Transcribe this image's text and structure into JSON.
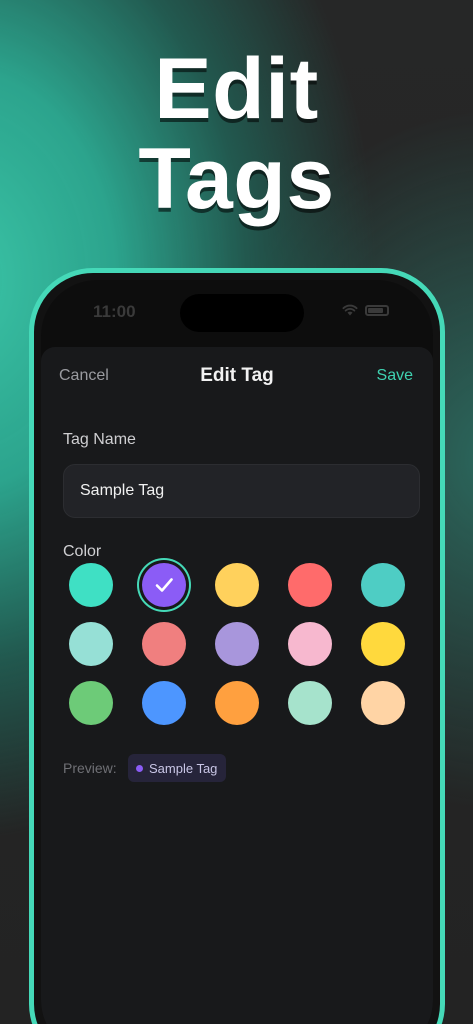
{
  "headline": {
    "line1": "Edit",
    "line2": "Tags"
  },
  "status_bar": {
    "time": "11:00"
  },
  "navbar": {
    "cancel": "Cancel",
    "title": "Edit Tag",
    "save": "Save"
  },
  "form": {
    "name_label": "Tag Name",
    "name_value": "Sample Tag",
    "color_label": "Color",
    "selected_color_index": 1,
    "colors": [
      "#3fe0c4",
      "#8b5cf6",
      "#ffd15c",
      "#ff6b6b",
      "#4ecdc4",
      "#96e0d6",
      "#f07f7f",
      "#a896dc",
      "#f7b8cf",
      "#ffd93d",
      "#6dcb78",
      "#4d96ff",
      "#ffa03f",
      "#a6e3cc",
      "#ffd4a5"
    ]
  },
  "preview": {
    "label": "Preview:",
    "chip_text": "Sample Tag",
    "chip_dot_color": "#8b5cf6"
  }
}
